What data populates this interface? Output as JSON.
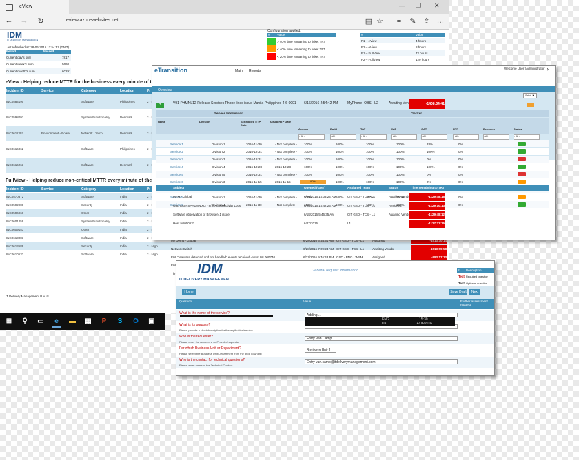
{
  "browser": {
    "tab_title": "eView",
    "url": "eview.azurewebsites.net"
  },
  "eview": {
    "logo_text": "IDM",
    "logo_sub": "IT DELIVERY MANAGEMENT",
    "last_refreshed": "Last refreshed at: 28-06-2016 11:54:57 (GMT)",
    "summary_headers": [
      "Period",
      "Missed"
    ],
    "summary_rows": [
      [
        "Current day's sum",
        "7817"
      ],
      [
        "Current week's sum",
        "5698"
      ],
      [
        "Current month's sum",
        "60291"
      ]
    ],
    "config_title": "Configuration applied:",
    "config_headers": [
      "#",
      "Value"
    ],
    "config_rows": [
      {
        "color": "#33cc33",
        "text": "> 40% time remaining to ticket TRT"
      },
      {
        "color": "#ff9900",
        "text": "< 40% time remaining to ticket TRT"
      },
      {
        "color": "#ff0000",
        "text": "< 20% time remaining to ticket TRT"
      }
    ],
    "prio_headers": [
      "#",
      "Value"
    ],
    "prio_rows": [
      [
        "P1 – eView",
        "4 hours"
      ],
      [
        "P2 – eView",
        "8 hours"
      ],
      [
        "P1 – FullView",
        "72 hours"
      ],
      [
        "P2 – FullView",
        "120 hours"
      ]
    ],
    "section1_title": "eView - Helping reduce MTTR for the business every minute of the day (showing 5 of 5)",
    "section1_headers": [
      "Incident ID",
      "Service",
      "Category",
      "Location",
      "Pr"
    ],
    "section1_rows": [
      [
        "INC0584190",
        "",
        "Software",
        "Philippines",
        "2 - High"
      ],
      [
        "INC0598097",
        "",
        "System Functionality",
        "Denmark",
        "2 - High"
      ],
      [
        "INC0611303",
        "Environment - Power",
        "Network / Telco",
        "Denmark",
        "2 - High"
      ],
      [
        "INC0616062",
        "",
        "Software",
        "Philippines",
        "2 - High"
      ],
      [
        "INC0616263",
        "",
        "Software",
        "Denmark",
        "2 - High"
      ]
    ],
    "section2_title": "FullView - Helping reduce non-critical MTTR every minute of the day",
    "section2_headers": [
      "Incident ID",
      "Service",
      "Category",
      "Location",
      "Pr"
    ],
    "section2_rows": [
      [
        "INC0570872",
        "",
        "Software",
        "India",
        "2 - High"
      ],
      [
        "INC0592988",
        "",
        "Security",
        "India",
        "2 - High"
      ],
      [
        "INC0596966",
        "",
        "Other",
        "India",
        "2 - High"
      ],
      [
        "INC0601259",
        "",
        "System Functionality",
        "India",
        "2 - High"
      ],
      [
        "INC0609153",
        "",
        "Other",
        "India",
        "2 - High"
      ],
      [
        "INC0613083",
        "",
        "Software",
        "India",
        "2 - High"
      ],
      [
        "INC0613589",
        "",
        "Security",
        "India",
        "2 - High"
      ],
      [
        "INC0610532",
        "",
        "Software",
        "India",
        "2 - High"
      ]
    ],
    "right_rows2": [
      {
        "s": "My Demo - Global",
        "d": "6/28/2016 6:54:31 AM",
        "g": "CIT GSD - TCS - L1",
        "st": "Assigned",
        "t": "-1513:30:14"
      },
      {
        "s": "Network Switch",
        "d": "6/28/2016 7:29:24 AM",
        "g": "CIT GSD - TCS - L1",
        "st": "Awaiting Vendor",
        "t": "-1513:59:58"
      },
      {
        "s": "FW: \"Malware detected and not handled\" events received - Host INL000740",
        "d": "6/27/2016 9:46:43 PM",
        "g": "GSC - PNG - WSM",
        "st": "Assigned",
        "t": "-983:17:13"
      },
      {
        "s": "FW: \"Malware detected and not handled\" events received - Host INL008577",
        "d": "6/28/2016 5:43:28 PM",
        "g": "GSC - PNG - WSM",
        "st": "Assigned",
        "t": "-983:15:56"
      },
      {
        "s": "Threat Outage",
        "d": "6/28/2016 8:23:41 AM",
        "g": "NEU - RUS - WSM",
        "st": "Awaiting User Info",
        "t": "-987:05:48"
      }
    ],
    "footer": "IT Delivery Management B.V. ©"
  },
  "etrans": {
    "title": "eTransition",
    "nav": [
      "Main",
      "Reports"
    ],
    "user": "Welcome User (Administrator)",
    "overview_label": "Overview",
    "print_label": "Print ▼",
    "top_row": {
      "id": "INC0584190",
      "subject": "V91-PHMNL12-Release Services Phone lines issue-Manila-Philippines-4-6-0001",
      "date": "6/16/2016 2:54:42 PM",
      "group": "MyPhone- OBS - L2",
      "status": "Awaiting Vendor",
      "time": "-1408:34:41"
    },
    "service_info": "Service Information",
    "tracker": "Tracker",
    "pr_row": "PR - RUKL003 - Site down - PKG2838 - Kaliningrad - Russia - 968634344",
    "col_headers": [
      "Name",
      "Division",
      "Scheduled ETP Date",
      "Actual RTP Date",
      "Access",
      "Build",
      "TAT",
      "UAT",
      "OAT",
      "RTP",
      "Decomm",
      "Status"
    ],
    "filter": "- All -",
    "rows": [
      {
        "name": "Service 1",
        "div": "Division 1",
        "sch": "2016-11-30",
        "act": "- Not complete -",
        "p": [
          "100%",
          "100%",
          "100%",
          "100%",
          "33%",
          "0%"
        ],
        "st": "#33aa33"
      },
      {
        "name": "Service 2",
        "div": "Division 2",
        "sch": "2016-12-31",
        "act": "- Not complete -",
        "p": [
          "100%",
          "100%",
          "100%",
          "100%",
          "100%",
          "0%"
        ],
        "st": "#33aa33"
      },
      {
        "name": "Service 3",
        "div": "Division 3",
        "sch": "2016-12-31",
        "act": "- Not complete -",
        "p": [
          "100%",
          "100%",
          "100%",
          "100%",
          "0%",
          "0%"
        ],
        "st": "#dd3333"
      },
      {
        "name": "Service 4",
        "div": "Division 4",
        "sch": "2016-10-28",
        "act": "2016-10-28",
        "p": [
          "100%",
          "100%",
          "100%",
          "100%",
          "100%",
          "0%"
        ],
        "st": "#33aa33"
      },
      {
        "name": "Service 5",
        "div": "Division 5",
        "sch": "2016-12-31",
        "act": "- Not complete -",
        "p": [
          "100%",
          "100%",
          "100%",
          "100%",
          "0%",
          "0%"
        ],
        "st": "#dd3333"
      },
      {
        "name": "Service 6",
        "div": "Division 3",
        "sch": "2016-11-15",
        "act": "2016-11-15",
        "p": [
          "90%",
          "100%",
          "100%",
          "100%",
          "0%",
          "0%"
        ],
        "st": "#ff9900"
      },
      {
        "name": "Service 7",
        "div": "Division 2",
        "sch": "2016-11-30",
        "act": "- Not complete -",
        "p": [
          "100%",
          "100%",
          "100%",
          "100%",
          "0%",
          "0%"
        ],
        "st": "#ff9900"
      },
      {
        "name": "Service 8",
        "div": "Division 1",
        "sch": "2016-11-30",
        "act": "- Not complete -",
        "p": [
          "100%",
          "100%",
          "100%",
          "100%",
          "0%",
          "0%"
        ],
        "st": "#ff9900"
      },
      {
        "name": "Service 9",
        "div": "Division 4",
        "sch": "2016-11-30",
        "act": "- Not complete -",
        "p": [
          "100%",
          "100%",
          "100%",
          "100%",
          "0%",
          "0%"
        ],
        "st": "#33aa33"
      }
    ],
    "mid_headers": [
      "Subject",
      "Opened (GMT)",
      "Assigned Team",
      "Status",
      "Time remaining to TRT"
    ],
    "mid_rows": [
      {
        "subject": "MFM - Global",
        "date": "6/28/2016 10:03:24 AM",
        "group": "CIT GSD - TCS - L1",
        "status": "Awaiting Vendor",
        "time": "-1129:48:18"
      },
      {
        "subject": "Got: SAVPSPH1MN003 - 8/SE Connectivity Loss",
        "date": "6/28/2016 10:42:23 AM",
        "group": "CIT GSD - TCS - L1",
        "status": "Assigned",
        "time": "-1129:10:13"
      },
      {
        "subject": "Software observation of Browser41 issue",
        "date": "6/18/2016 5:46:35 AM",
        "group": "CIT GSD - TCS - L1",
        "status": "Awaiting Vendor",
        "time": "-1129:48:12"
      },
      {
        "subject": "Host bsl000631",
        "date": "6/27/2016",
        "group": "L1",
        "status": "",
        "time": "-1127:21:15"
      }
    ]
  },
  "form": {
    "logo_text": "IDM",
    "logo_sub": "IT DELIVERY MANAGEMENT",
    "subtitle": "General request information",
    "legend_headers": [
      "#",
      "Description"
    ],
    "legend_rows": [
      [
        "Text",
        "Required question"
      ],
      [
        "Text",
        "Optional question"
      ]
    ],
    "home_label": "Home",
    "save_label": "Save Draft",
    "next_label": "Next",
    "col_headers": [
      "Question",
      "Value",
      "Further assessment request"
    ],
    "questions": [
      {
        "q": "What is the name of the service?",
        "s": "",
        "v": "Adding..."
      },
      {
        "q": "What is its purpose?",
        "s": "Please provide a short description for the application/service",
        "v": ""
      },
      {
        "q": "Who is the requester?",
        "s": "Please enter the name of a sc-Provider/requester",
        "v": "Entry Van Camp"
      },
      {
        "q": "For which Business Unit or Department?",
        "s": "Please select the Business Unit/Department from the drop down list",
        "v": "Business Unit 1"
      },
      {
        "q": "Who is the contact for technical questions?",
        "s": "Please enter name of the Technical Contact",
        "v": "Entry van.camp@itdeliverymanagement.com"
      }
    ],
    "tray": {
      "lang": "ENG",
      "time": "15:30",
      "region": "UK",
      "date": "14/06/2016"
    }
  },
  "taskbar": {
    "icons": [
      "windows-icon",
      "search-icon",
      "taskview-icon",
      "edge-icon",
      "explorer-icon",
      "store-icon",
      "powerpoint-icon",
      "skype-icon",
      "outlook-icon",
      "photos-icon"
    ]
  }
}
